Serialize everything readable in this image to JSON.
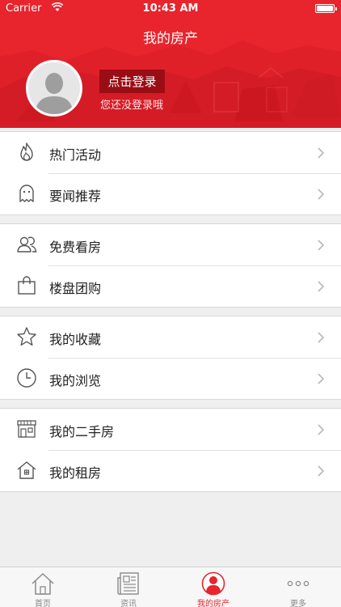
{
  "status_bar": {
    "carrier": "Carrier",
    "time": "10:43 AM"
  },
  "header": {
    "title": "我的房产",
    "login_button": "点击登录",
    "login_hint": "您还没登录哦"
  },
  "menu": {
    "groups": [
      {
        "items": [
          {
            "label": "热门活动",
            "icon": "flame-icon"
          },
          {
            "label": "要闻推荐",
            "icon": "ghost-icon"
          }
        ]
      },
      {
        "items": [
          {
            "label": "免费看房",
            "icon": "people-icon"
          },
          {
            "label": "楼盘团购",
            "icon": "shopping-bag-icon"
          }
        ]
      },
      {
        "items": [
          {
            "label": "我的收藏",
            "icon": "star-icon"
          },
          {
            "label": "我的浏览",
            "icon": "clock-icon"
          }
        ]
      },
      {
        "items": [
          {
            "label": "我的二手房",
            "icon": "storefront-icon"
          },
          {
            "label": "我的租房",
            "icon": "house-icon"
          }
        ]
      }
    ]
  },
  "tabbar": {
    "tabs": [
      {
        "label": "首页",
        "icon": "home-icon"
      },
      {
        "label": "资讯",
        "icon": "newspaper-icon"
      },
      {
        "label": "我的房产",
        "icon": "user-icon"
      },
      {
        "label": "更多",
        "icon": "more-icon"
      }
    ],
    "active_index": 2
  },
  "colors": {
    "accent": "#e8242d",
    "login_button": "#9a0d14",
    "background": "#efefef"
  }
}
